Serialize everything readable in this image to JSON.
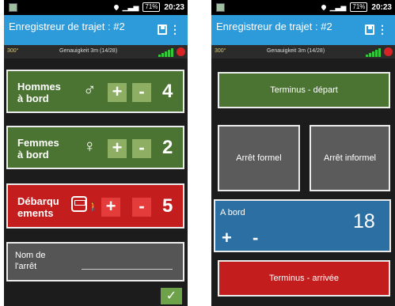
{
  "left": {
    "status": {
      "time": "20:23",
      "battery": "71%"
    },
    "appbar": {
      "title": "Enregistreur de trajet : #2"
    },
    "gps": {
      "heading": "300°",
      "accuracy": "Genauigkeit 3m (14/28)"
    },
    "men": {
      "label_line1": "Hommes",
      "label_line2": "à bord",
      "count": "4",
      "plus": "+",
      "minus": "-"
    },
    "women": {
      "label_line1": "Femmes",
      "label_line2": "à bord",
      "count": "2",
      "plus": "+",
      "minus": "-"
    },
    "alight": {
      "label_line1": "Débarqu",
      "label_line2": "ements",
      "count": "5",
      "plus": "+",
      "minus": "-"
    },
    "stop": {
      "label_line1": "Nom de",
      "label_line2": "l'arrêt"
    },
    "confirm": "✓"
  },
  "right": {
    "status": {
      "time": "20:23",
      "battery": "71%"
    },
    "appbar": {
      "title": "Enregistreur de trajet : #2"
    },
    "gps": {
      "heading": "300°",
      "accuracy": "Genauigkeit 3m (14/28)"
    },
    "terminus_depart": "Terminus - départ",
    "arret_formel": "Arrêt formel",
    "arret_informel": "Arrêt informel",
    "onboard": {
      "label": "A bord",
      "count": "18",
      "plus": "+",
      "minus": "-"
    },
    "terminus_arrivee": "Terminus - arrivée"
  },
  "colors": {
    "appbar": "#2d9ad9",
    "green": "#4b7433",
    "red": "#c31d1d",
    "blue": "#2b6fa3"
  }
}
